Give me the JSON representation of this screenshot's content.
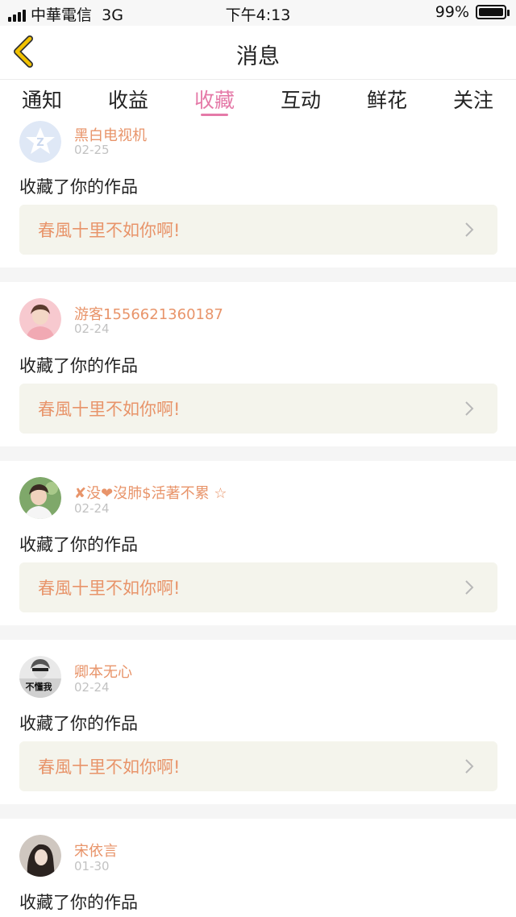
{
  "status_bar": {
    "carrier": "中華電信",
    "network": "3G",
    "time": "下午4:13",
    "battery_percent": "99%"
  },
  "header": {
    "title": "消息",
    "back_icon": "chevron-left-icon",
    "accent_color": "#f2c200"
  },
  "tabs": [
    {
      "label": "通知",
      "active": false
    },
    {
      "label": "收益",
      "active": false
    },
    {
      "label": "收藏",
      "active": true
    },
    {
      "label": "互动",
      "active": false
    },
    {
      "label": "鲜花",
      "active": false
    },
    {
      "label": "关注",
      "active": false
    }
  ],
  "colors": {
    "tab_active": "#e57aa8",
    "username": "#e8946a",
    "card_bg": "#f4f4ec"
  },
  "items": [
    {
      "username": "黑白电视机",
      "date": "02-25",
      "action": "收藏了你的作品",
      "work_title": "春風十里不如你啊!"
    },
    {
      "username": "游客1556621360187",
      "date": "02-24",
      "action": "收藏了你的作品",
      "work_title": "春風十里不如你啊!"
    },
    {
      "username": "✘没❤沒肺$活著不累 ☆",
      "date": "02-24",
      "action": "收藏了你的作品",
      "work_title": "春風十里不如你啊!"
    },
    {
      "username": "卿本无心",
      "date": "02-24",
      "action": "收藏了你的作品",
      "work_title": "春風十里不如你啊!"
    },
    {
      "username": "宋依言",
      "date": "01-30",
      "action": "收藏了你的作品",
      "work_title": ""
    }
  ],
  "avatar_badge_text": "不懂我"
}
